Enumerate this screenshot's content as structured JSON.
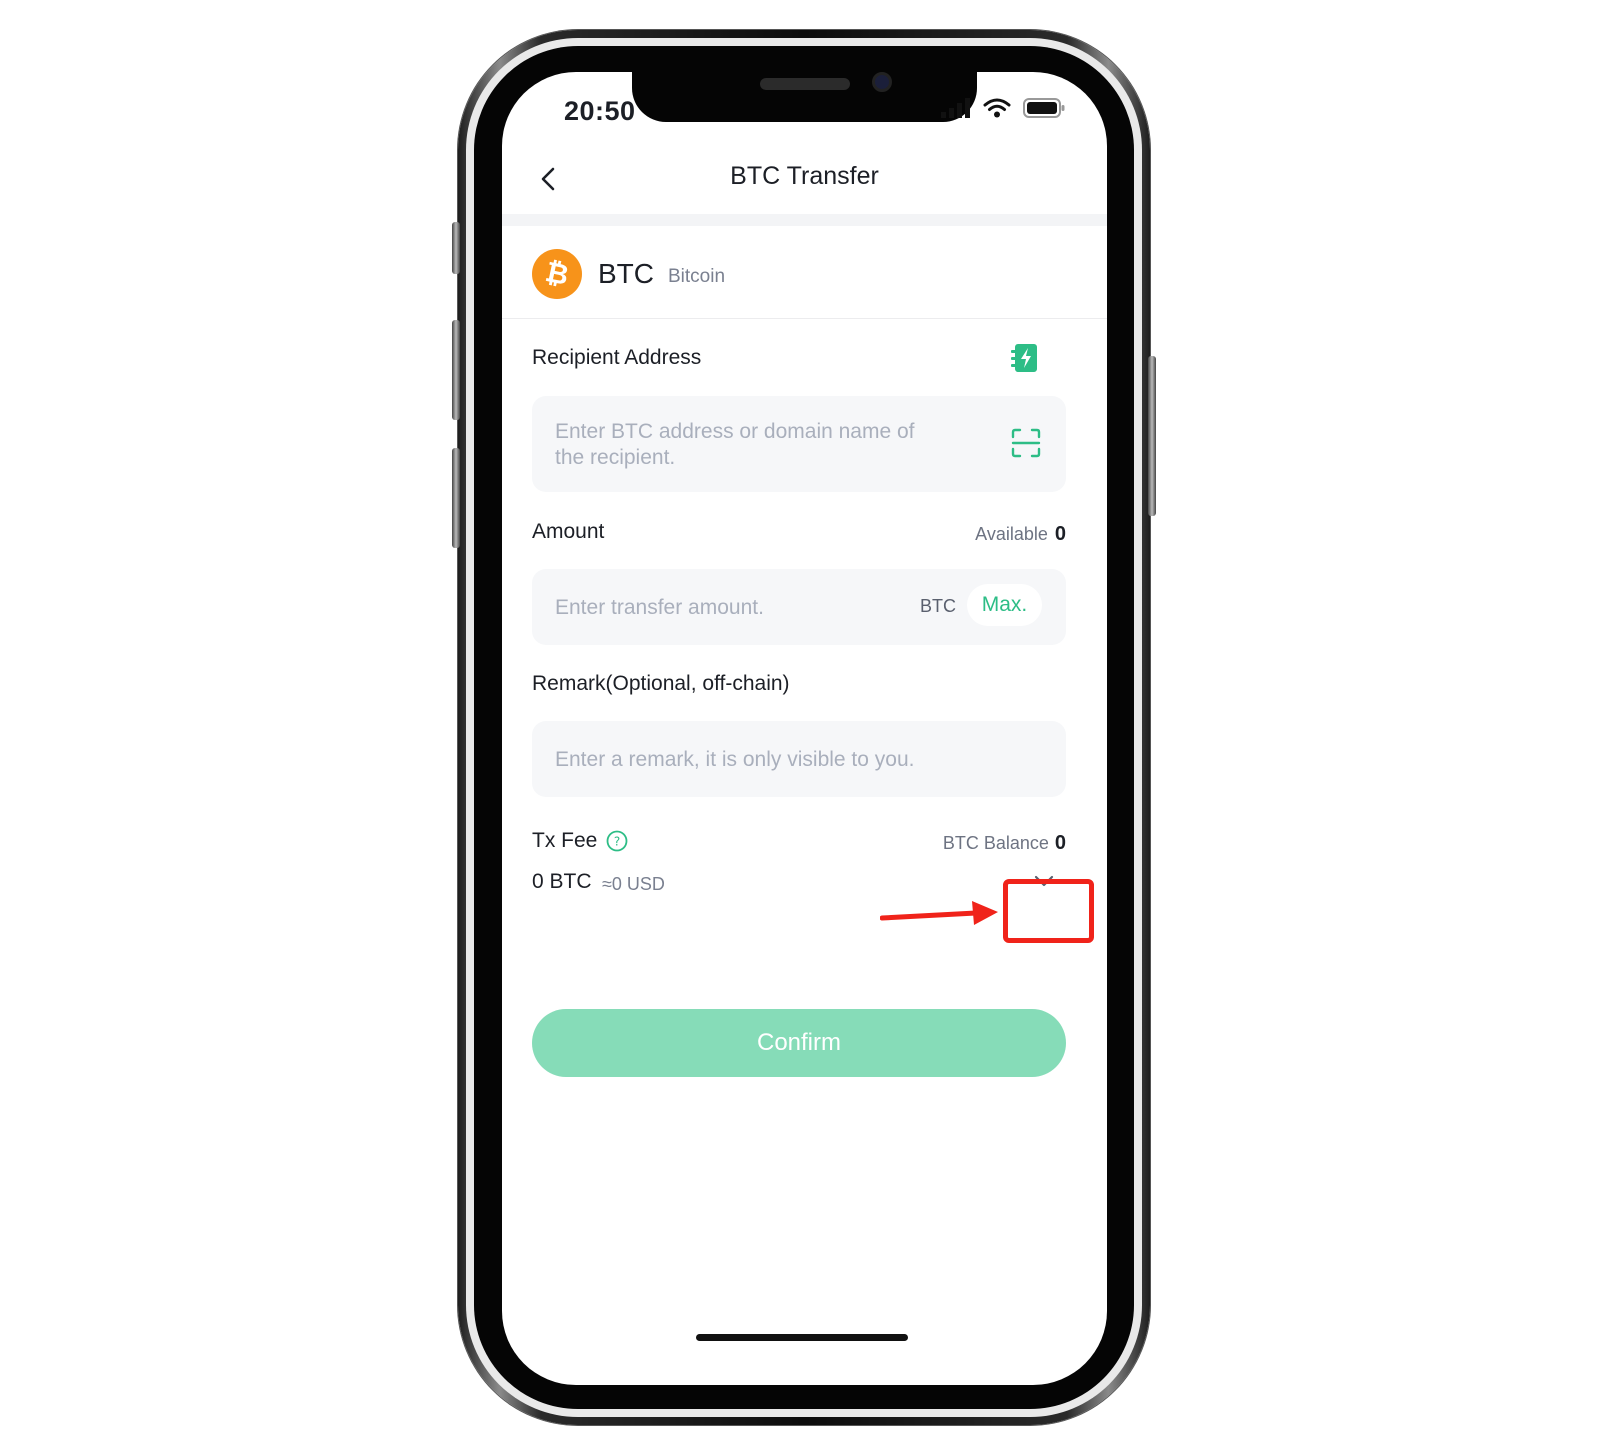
{
  "status_bar": {
    "time": "20:50"
  },
  "nav": {
    "title": "BTC Transfer",
    "back_icon": "chevron-left-icon"
  },
  "coin": {
    "symbol": "BTC",
    "name": "Bitcoin",
    "logo_color": "#f7931a"
  },
  "recipient": {
    "label": "Recipient Address",
    "placeholder_line1": "Enter BTC address or domain name of",
    "placeholder_line2": "the recipient."
  },
  "amount": {
    "label": "Amount",
    "available_label": "Available",
    "available_value": "0",
    "placeholder": "Enter transfer amount.",
    "unit": "BTC",
    "max_label": "Max."
  },
  "remark": {
    "label": "Remark(Optional, off-chain)",
    "placeholder": "Enter a remark, it is only visible to you."
  },
  "fee": {
    "label": "Tx Fee",
    "balance_label": "BTC Balance",
    "balance_value": "0",
    "amount": "0 BTC",
    "usd": "≈0 USD"
  },
  "confirm": {
    "label": "Confirm"
  },
  "colors": {
    "accent": "#2dbd86",
    "confirm_bg": "#86dcb8",
    "annotation": "#f0231a"
  }
}
